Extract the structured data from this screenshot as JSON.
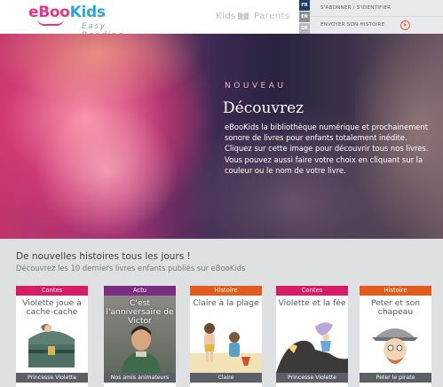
{
  "header": {
    "logo_text_prefix": "eBoo",
    "logo_text_suffix": "Kids",
    "tagline": "Easy Reading",
    "nav_kids": "Kids",
    "nav_parents": "Parents",
    "languages": [
      {
        "code": "FR"
      },
      {
        "code": "EN"
      },
      {
        "code": "DE"
      }
    ],
    "subscribe_label": "S'ABONNER / S'IDENTIFIER",
    "send_story_label": "ENVOYER SON HISTOIRE"
  },
  "hero": {
    "kicker": "NOUVEAU",
    "title": "Découvrez",
    "body": "eBooKids la bibliothèque numérique et prochainement sonore de livres pour enfants totalement inédite. Cliquez sur cette image pour découvrir tous nos livres. Vous pouvez aussi faire votre choix en cliquant sur la couleur ou le nom de votre livre."
  },
  "section": {
    "title": "De nouvelles histoires tous les jours !",
    "subtitle": "Découvrez les 10 derniers livres enfants publiés sur eBooKids"
  },
  "cards": [
    {
      "tag": "Contes",
      "tag_color": "#d81b67",
      "title": "Violette joue à cache-cache",
      "name": "Princesse Violette",
      "art": "chest"
    },
    {
      "tag": "Actu",
      "tag_color": "#7b2c83",
      "title": "C'est l'anniversaire de Victor",
      "name": "Nos amis animateurs",
      "art": "portrait"
    },
    {
      "tag": "Histoire",
      "tag_color": "#e35c1e",
      "title": "Claire à la plage",
      "name": "Claire",
      "art": "beach"
    },
    {
      "tag": "Contes",
      "tag_color": "#d81b67",
      "title": "Violette et la fée",
      "name": "Princesse Violette",
      "art": "fairy"
    },
    {
      "tag": "Histoire",
      "tag_color": "#e35c1e",
      "title": "Peter et son chapeau",
      "name": "Peter le pirate",
      "art": "pirate"
    }
  ],
  "icons": {
    "send": "send-icon",
    "book": "book-icon"
  }
}
